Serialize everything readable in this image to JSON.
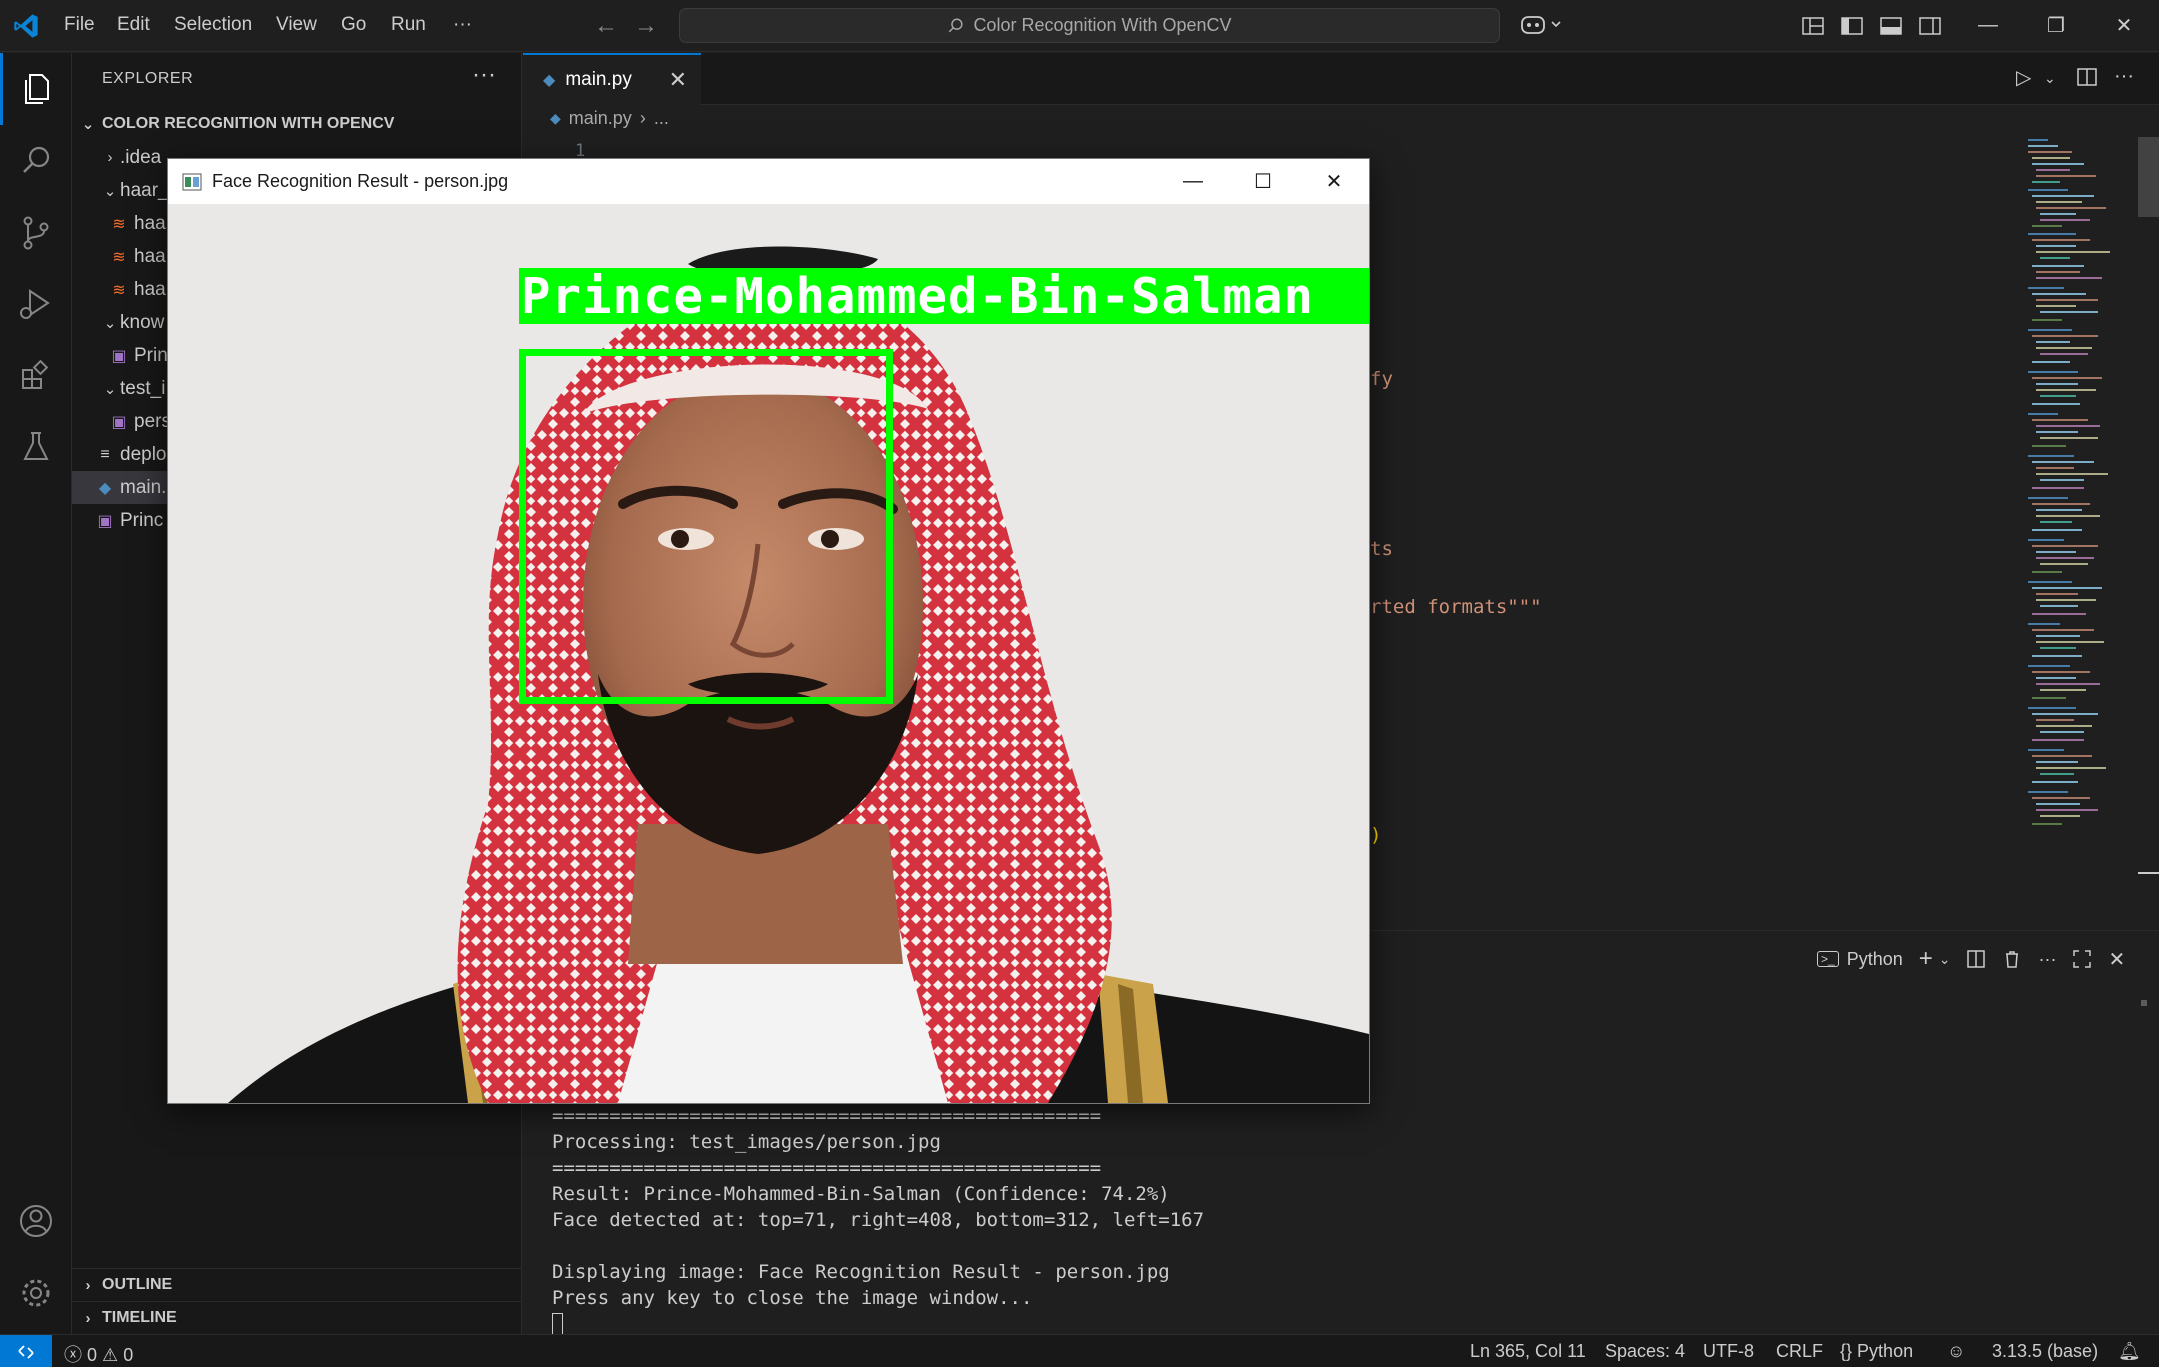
{
  "menu": {
    "file": "File",
    "edit": "Edit",
    "selection": "Selection",
    "view": "View",
    "go": "Go",
    "run": "Run",
    "more": "···"
  },
  "command_center": {
    "label": "Color Recognition With OpenCV"
  },
  "window_controls": {
    "minimize": "—",
    "restore": "❐",
    "close": "✕"
  },
  "sidebar": {
    "title": "EXPLORER",
    "more": "···",
    "project": "COLOR RECOGNITION WITH OPENCV",
    "items": [
      {
        "label": ".idea",
        "chevron": "›",
        "icon": ""
      },
      {
        "label": "haar_",
        "chevron": "⌄",
        "icon": ""
      },
      {
        "label": "haa",
        "chevron": "",
        "icon": "≋"
      },
      {
        "label": "haa",
        "chevron": "",
        "icon": "≋"
      },
      {
        "label": "haa",
        "chevron": "",
        "icon": "≋"
      },
      {
        "label": "know",
        "chevron": "⌄",
        "icon": ""
      },
      {
        "label": "Prin",
        "chevron": "",
        "icon": "▣"
      },
      {
        "label": "test_i",
        "chevron": "⌄",
        "icon": ""
      },
      {
        "label": "pers",
        "chevron": "",
        "icon": "▣"
      },
      {
        "label": "deplo",
        "chevron": "",
        "icon": "≡"
      },
      {
        "label": "main.",
        "chevron": "",
        "icon": "◆"
      },
      {
        "label": "Princ",
        "chevron": "",
        "icon": "▣"
      }
    ],
    "outline": "OUTLINE",
    "timeline": "TIMELINE"
  },
  "editor": {
    "tab_label": "main.py",
    "tab_close": "✕",
    "breadcrumb_file": "main.py",
    "breadcrumb_sep": "›",
    "breadcrumb_more": "...",
    "line_number": "1",
    "fragments": {
      "f1": "fy",
      "f2": "ts",
      "f3": "rted formats\"\"\"",
      "f4": ")"
    }
  },
  "panel": {
    "terminal_profile": "Python",
    "terminal_lines": [
      "================================================",
      "Processing: test_images/person.jpg",
      "================================================",
      "Result: Prince-Mohammed-Bin-Salman (Confidence: 74.2%)",
      "Face detected at: top=71, right=408, bottom=312, left=167",
      "",
      "Displaying image: Face Recognition Result - person.jpg",
      "Press any key to close the image window..."
    ]
  },
  "statusbar": {
    "errors": "0",
    "warnings": "0",
    "position": "Ln 365, Col 11",
    "spaces": "Spaces: 4",
    "encoding": "UTF-8",
    "eol": "CRLF",
    "language": "Python",
    "interpreter": "3.13.5 (base)"
  },
  "cv_window": {
    "title": "Face Recognition Result - person.jpg",
    "label": "Prince-Mohammed-Bin-Salman",
    "box_color": "#00ff00"
  },
  "colors": {
    "accent": "#0078d4",
    "bg": "#1f1f1f",
    "sidebar": "#181818"
  }
}
